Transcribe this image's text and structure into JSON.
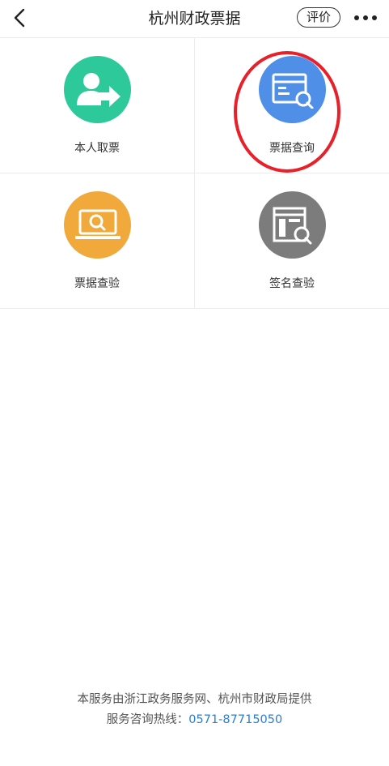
{
  "nav": {
    "title": "杭州财政票据",
    "rate_label": "评价",
    "back_icon": "chevron-left-icon",
    "more_icon": "more-horizontal-icon"
  },
  "tiles": [
    {
      "label": "本人取票",
      "icon": "user-arrow-icon",
      "color": "#2ec99a"
    },
    {
      "label": "票据查询",
      "icon": "window-search-icon",
      "color": "#4f8fe8"
    },
    {
      "label": "票据查验",
      "icon": "laptop-search-icon",
      "color": "#f0a93a"
    },
    {
      "label": "签名查验",
      "icon": "document-search-icon",
      "color": "#7c7c7c"
    }
  ],
  "footer": {
    "line1": "本服务由浙江政务服务网、杭州市财政局提供",
    "hotline_label": "服务咨询热线：",
    "hotline_number": "0571-87715050"
  },
  "colors": {
    "highlight": "#e8202a",
    "link": "#2a7fd4"
  }
}
